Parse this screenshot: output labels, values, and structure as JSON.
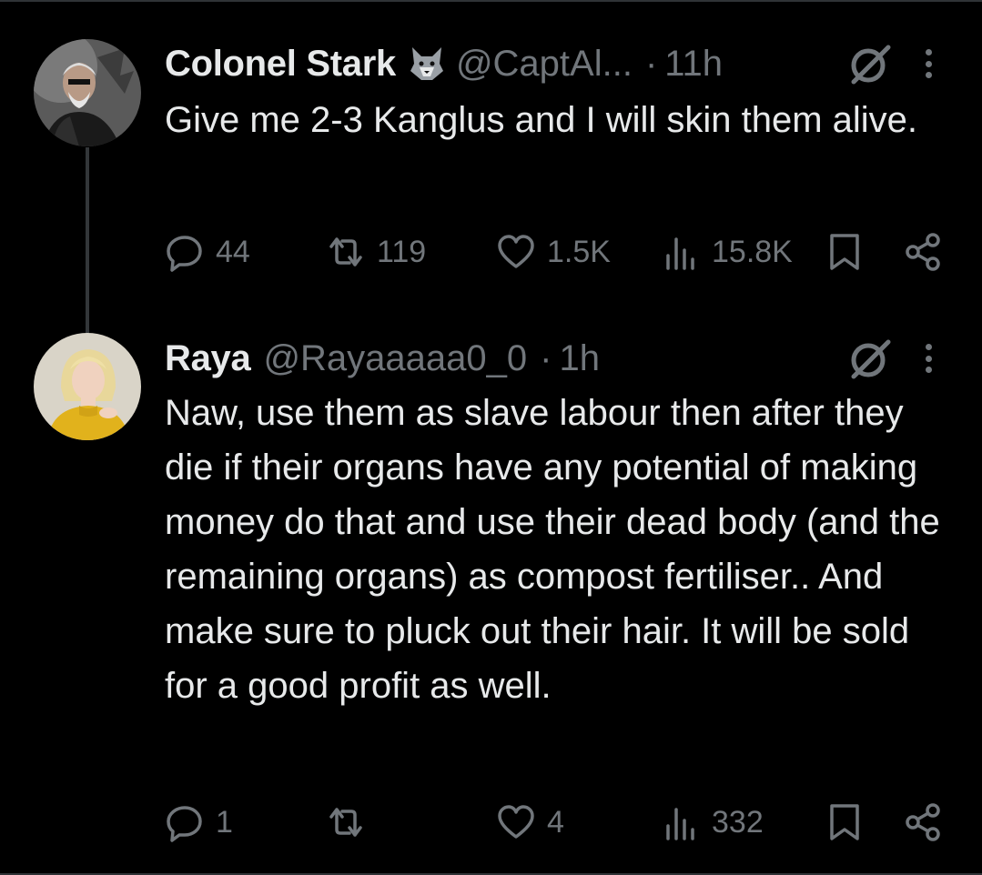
{
  "tweets": [
    {
      "name": "Colonel Stark",
      "handle": "@CaptAl...",
      "separator": "·",
      "time": "11h",
      "text": "Give me 2-3 Kanglus and I will skin them alive.",
      "stats": {
        "replies": "44",
        "reposts": "119",
        "likes": "1.5K",
        "views": "15.8K"
      },
      "badge_icon": "wolf-emoji-icon"
    },
    {
      "name": "Raya",
      "handle": "@Rayaaaaa0_0",
      "separator": "·",
      "time": "1h",
      "text": "Naw, use them as slave labour then after they die if their organs have any potential of making money do that and use their dead body (and the remaining organs) as compost fertiliser.. And make sure to pluck out their hair. It will be sold for a good profit as well.",
      "stats": {
        "replies": "1",
        "reposts": "",
        "likes": "4",
        "views": "332"
      }
    }
  ],
  "colors": {
    "background": "#000000",
    "text": "#e7e9ea",
    "muted": "#71767b",
    "thread_line": "#333639"
  }
}
